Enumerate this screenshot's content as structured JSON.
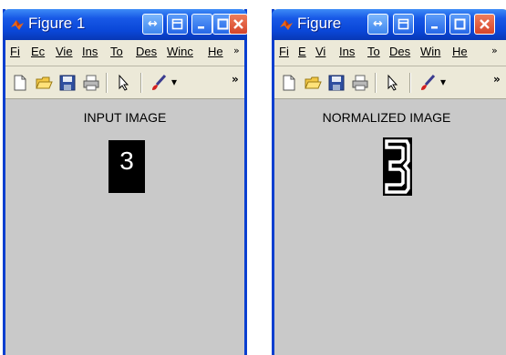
{
  "windows": [
    {
      "id": "input",
      "title": "Figure 1",
      "menu": [
        "Fi",
        "Ec",
        "Vie",
        "Ins",
        "To",
        "Des",
        "Winc",
        "He"
      ],
      "figure_title": "INPUT IMAGE",
      "image_glyph": "3"
    },
    {
      "id": "normalized",
      "title": "Figure",
      "menu": [
        "Fi",
        "E",
        "Vi",
        "Ins",
        "To",
        "Des",
        "Win",
        "He"
      ],
      "figure_title": "NORMALIZED IMAGE"
    }
  ],
  "menu_overflow": "»",
  "toolbar_overflow": "»",
  "icons": {
    "app": "matlab-logo-icon",
    "title_buttons": [
      "dock-icon",
      "restore-icon",
      "minimize-icon",
      "maximize-icon",
      "close-icon"
    ],
    "toolbar": [
      "new-file-icon",
      "open-folder-icon",
      "save-icon",
      "print-icon",
      "select-arrow-icon",
      "brush-icon",
      "dropdown-icon"
    ]
  },
  "colors": {
    "titlebar": "#0a47d8",
    "window_face": "#ece9d8",
    "figure_bg": "#c9c9c9",
    "close_button": "#d5452a"
  }
}
